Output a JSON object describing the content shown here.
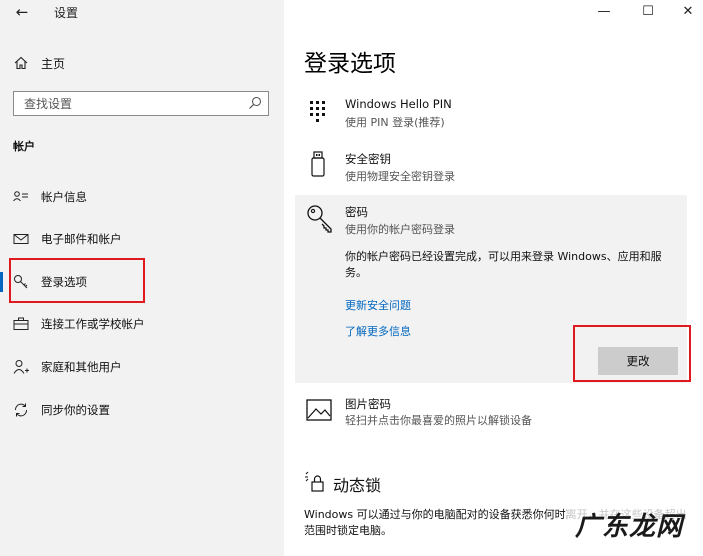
{
  "window": {
    "title": "设置",
    "back_glyph": "←",
    "minimize_glyph": "—",
    "maximize_glyph": "☐",
    "close_glyph": "✕"
  },
  "sidebar": {
    "home_label": "主页",
    "search_placeholder": "查找设置",
    "section_header": "帐户",
    "items": [
      {
        "label": "帐户信息",
        "icon": "account-info-icon"
      },
      {
        "label": "电子邮件和帐户",
        "icon": "mail-icon"
      },
      {
        "label": "登录选项",
        "icon": "key-icon",
        "active": true
      },
      {
        "label": "连接工作或学校帐户",
        "icon": "briefcase-icon"
      },
      {
        "label": "家庭和其他用户",
        "icon": "person-add-icon"
      },
      {
        "label": "同步你的设置",
        "icon": "sync-icon"
      }
    ]
  },
  "main": {
    "title": "登录选项",
    "options": [
      {
        "title": "Windows Hello PIN",
        "subtitle": "使用 PIN 登录(推荐)",
        "icon": "pin-keypad-icon"
      },
      {
        "title": "安全密钥",
        "subtitle": "使用物理安全密钥登录",
        "icon": "usb-key-icon"
      },
      {
        "title": "密码",
        "subtitle": "使用你的帐户密码登录",
        "icon": "password-key-icon"
      },
      {
        "title": "图片密码",
        "subtitle": "轻扫并点击你最喜爱的照片以解锁设备",
        "icon": "picture-icon"
      }
    ],
    "password_expanded": {
      "description": "你的帐户密码已经设置完成，可以用来登录 Windows、应用和服务。",
      "link_security_questions": "更新安全问题",
      "link_learn_more": "了解更多信息",
      "change_button": "更改"
    },
    "dynamic_lock": {
      "title": "动态锁",
      "description": "Windows 可以通过与你的电脑配对的设备获悉你何时离开，并在这些设备超出范围时锁定电脑。"
    }
  },
  "watermark": {
    "text": "广东龙网"
  },
  "colors": {
    "accent": "#0067c0",
    "highlight": "#e0191f",
    "sidebar_bg": "#f2f2f2",
    "button_bg": "#cccccc"
  }
}
